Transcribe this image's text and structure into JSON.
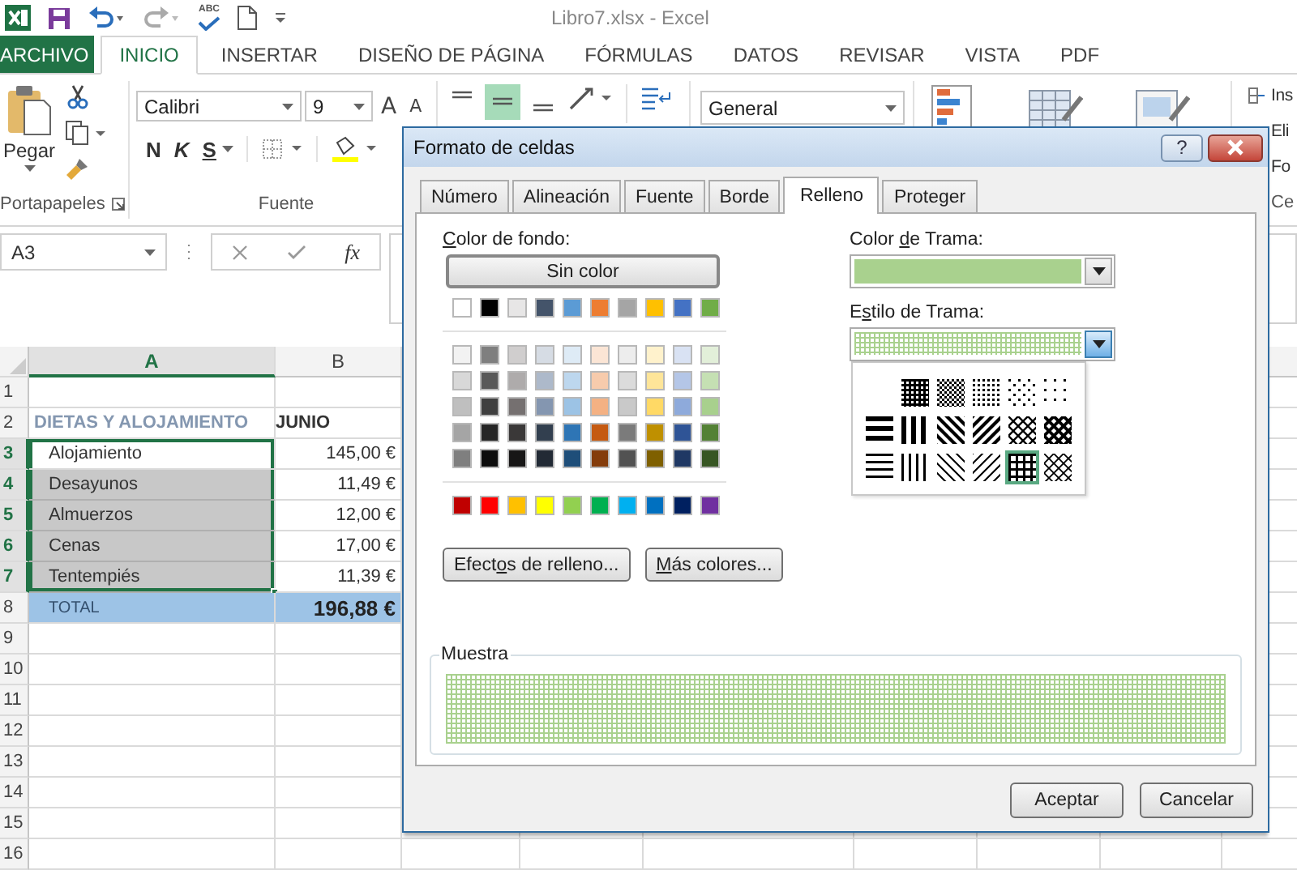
{
  "title_bar": {
    "title": "Libro7.xlsx - Excel",
    "spelling_label": "ABC"
  },
  "ribbon_tabs": [
    {
      "label": "ARCHIVO",
      "kind": "file",
      "selected": false
    },
    {
      "label": "INICIO",
      "kind": "tab",
      "selected": true
    },
    {
      "label": "INSERTAR",
      "kind": "tab",
      "selected": false
    },
    {
      "label": "DISEÑO DE PÁGINA",
      "kind": "tab",
      "selected": false
    },
    {
      "label": "FÓRMULAS",
      "kind": "tab",
      "selected": false
    },
    {
      "label": "DATOS",
      "kind": "tab",
      "selected": false
    },
    {
      "label": "REVISAR",
      "kind": "tab",
      "selected": false
    },
    {
      "label": "VISTA",
      "kind": "tab",
      "selected": false
    },
    {
      "label": "PDF",
      "kind": "tab",
      "selected": false
    }
  ],
  "ribbon": {
    "paste": "Pegar",
    "clipboard_group": "Portapapeles",
    "font_name": "Calibri",
    "font_size": "9",
    "grow_font": "A",
    "shrink_font": "A",
    "bold": "N",
    "italic": "K",
    "underline": "S",
    "font_group": "Fuente",
    "alignments": [
      {
        "kind": "top",
        "selected": false
      },
      {
        "kind": "middle",
        "selected": true
      },
      {
        "kind": "bottom",
        "selected": false
      }
    ],
    "number_format": "General",
    "cells_commands": [
      "Ins",
      "Eli",
      "Fo"
    ],
    "cells_group": "Ce"
  },
  "formula_bar": {
    "name_box": "A3",
    "function_label": "fx"
  },
  "sheet": {
    "columns": [
      {
        "label": "A",
        "selected": true
      },
      {
        "label": "B",
        "selected": false
      }
    ],
    "rows": [
      {
        "number": "1",
        "selected": false,
        "kind": "blank"
      },
      {
        "number": "2",
        "selected": false,
        "kind": "heading",
        "cells": [
          {
            "text": "DIETAS Y ALOJAMIENTO",
            "shaded": false
          },
          {
            "text": "JUNIO",
            "shaded": false
          }
        ]
      },
      {
        "number": "3",
        "selected": true,
        "kind": "item",
        "cells": [
          {
            "text": "Alojamiento",
            "shaded": false
          },
          {
            "text": "145,00 €",
            "shaded": false
          }
        ]
      },
      {
        "number": "4",
        "selected": true,
        "kind": "item",
        "cells": [
          {
            "text": "Desayunos",
            "shaded": true
          },
          {
            "text": "11,49 €",
            "shaded": false
          }
        ]
      },
      {
        "number": "5",
        "selected": true,
        "kind": "item",
        "cells": [
          {
            "text": "Almuerzos",
            "shaded": true
          },
          {
            "text": "12,00 €",
            "shaded": false
          }
        ]
      },
      {
        "number": "6",
        "selected": true,
        "kind": "item",
        "cells": [
          {
            "text": "Cenas",
            "shaded": true
          },
          {
            "text": "17,00 €",
            "shaded": false
          }
        ]
      },
      {
        "number": "7",
        "selected": true,
        "kind": "item",
        "cells": [
          {
            "text": "Tentempiés",
            "shaded": true
          },
          {
            "text": "11,39 €",
            "shaded": false
          }
        ]
      },
      {
        "number": "8",
        "selected": false,
        "kind": "total",
        "cells": [
          {
            "text": "TOTAL",
            "shaded": false
          },
          {
            "text": "196,88 €",
            "shaded": false
          }
        ]
      },
      {
        "number": "9",
        "selected": false,
        "kind": "blank"
      },
      {
        "number": "10",
        "selected": false,
        "kind": "blank"
      },
      {
        "number": "11",
        "selected": false,
        "kind": "blank"
      },
      {
        "number": "12",
        "selected": false,
        "kind": "blank"
      },
      {
        "number": "13",
        "selected": false,
        "kind": "blank"
      },
      {
        "number": "14",
        "selected": false,
        "kind": "blank"
      },
      {
        "number": "15",
        "selected": false,
        "kind": "blank"
      },
      {
        "number": "16",
        "selected": false,
        "kind": "blank"
      }
    ]
  },
  "dialog": {
    "title": "Formato de celdas",
    "help_button": "?",
    "tabs": [
      {
        "label": "Número",
        "selected": false
      },
      {
        "label": "Alineación",
        "selected": false
      },
      {
        "label": "Fuente",
        "selected": false
      },
      {
        "label": "Borde",
        "selected": false
      },
      {
        "label": "Relleno",
        "selected": true
      },
      {
        "label": "Proteger",
        "selected": false
      }
    ],
    "background_color": {
      "label": {
        "key": "C",
        "post": "olor de fondo:"
      },
      "no_color_button": "Sin color",
      "theme_colors": [
        {
          "color": "#ffffff"
        },
        {
          "color": "#000000"
        },
        {
          "color": "#e7e6e6"
        },
        {
          "color": "#44546a"
        },
        {
          "color": "#5b9bd5"
        },
        {
          "color": "#ed7d31"
        },
        {
          "color": "#a5a5a5"
        },
        {
          "color": "#ffc000"
        },
        {
          "color": "#4472c4"
        },
        {
          "color": "#70ad47"
        }
      ],
      "shade_rows": [
        [
          {
            "color": "#f2f2f2"
          },
          {
            "color": "#7f7f7f"
          },
          {
            "color": "#d0cece"
          },
          {
            "color": "#d6dce4"
          },
          {
            "color": "#deebf6"
          },
          {
            "color": "#fbe5d5"
          },
          {
            "color": "#ededed"
          },
          {
            "color": "#fff2cc"
          },
          {
            "color": "#d9e2f3"
          },
          {
            "color": "#e2efd9"
          }
        ],
        [
          {
            "color": "#d8d8d8"
          },
          {
            "color": "#595959"
          },
          {
            "color": "#aeabab"
          },
          {
            "color": "#adb9ca"
          },
          {
            "color": "#bdd7ee"
          },
          {
            "color": "#f7cbac"
          },
          {
            "color": "#dbdbdb"
          },
          {
            "color": "#fee599"
          },
          {
            "color": "#b4c6e7"
          },
          {
            "color": "#c5e0b3"
          }
        ],
        [
          {
            "color": "#bfbfbf"
          },
          {
            "color": "#3f3f3f"
          },
          {
            "color": "#757070"
          },
          {
            "color": "#8496b0"
          },
          {
            "color": "#9cc3e5"
          },
          {
            "color": "#f4b183"
          },
          {
            "color": "#c9c9c9"
          },
          {
            "color": "#ffd965"
          },
          {
            "color": "#8eaadb"
          },
          {
            "color": "#a8d08d"
          }
        ],
        [
          {
            "color": "#a5a5a5"
          },
          {
            "color": "#262626"
          },
          {
            "color": "#3a3838"
          },
          {
            "color": "#323f4f"
          },
          {
            "color": "#2e75b5"
          },
          {
            "color": "#c55a11"
          },
          {
            "color": "#7b7b7b"
          },
          {
            "color": "#bf9000"
          },
          {
            "color": "#2f5496"
          },
          {
            "color": "#538135"
          }
        ],
        [
          {
            "color": "#7f7f7f"
          },
          {
            "color": "#0c0c0c"
          },
          {
            "color": "#171616"
          },
          {
            "color": "#222a35"
          },
          {
            "color": "#1e4e79"
          },
          {
            "color": "#843c0b"
          },
          {
            "color": "#525252"
          },
          {
            "color": "#7f6000"
          },
          {
            "color": "#1f3864"
          },
          {
            "color": "#375623"
          }
        ]
      ],
      "standard_colors": [
        {
          "color": "#c00000"
        },
        {
          "color": "#ff0000"
        },
        {
          "color": "#ffc000"
        },
        {
          "color": "#ffff00"
        },
        {
          "color": "#92d050"
        },
        {
          "color": "#00b050"
        },
        {
          "color": "#00b0f0"
        },
        {
          "color": "#0070c0"
        },
        {
          "color": "#002060"
        },
        {
          "color": "#7030a0"
        }
      ]
    },
    "fill_effects_button": {
      "pre": "Efect",
      "key": "o",
      "post": "s de relleno..."
    },
    "more_colors_button": {
      "key": "M",
      "post": "ás colores..."
    },
    "pattern_color": {
      "label": {
        "pre": "Color ",
        "key": "d",
        "post": "e Trama:"
      },
      "color": "#a9d18e"
    },
    "pattern_style": {
      "label": {
        "pre": "E",
        "key": "s",
        "post": "tilo de Trama:"
      },
      "expanded": true,
      "options": [
        {
          "kind": "gray-75",
          "selected": false
        },
        {
          "kind": "gray-50",
          "selected": false
        },
        {
          "kind": "gray-25",
          "selected": false
        },
        {
          "kind": "gray-12",
          "selected": false
        },
        {
          "kind": "gray-6",
          "selected": false
        },
        {
          "kind": "thick-horizontal",
          "selected": false
        },
        {
          "kind": "thick-vertical",
          "selected": false
        },
        {
          "kind": "thick-reverse-diagonal",
          "selected": false
        },
        {
          "kind": "thick-diagonal",
          "selected": false
        },
        {
          "kind": "diagonal-crosshatch",
          "selected": false
        },
        {
          "kind": "thick-diagonal-crosshatch",
          "selected": false
        },
        {
          "kind": "thin-horizontal",
          "selected": false
        },
        {
          "kind": "thin-vertical",
          "selected": false
        },
        {
          "kind": "thin-reverse-diagonal",
          "selected": false
        },
        {
          "kind": "thin-diagonal",
          "selected": false
        },
        {
          "kind": "thin-horizontal-crosshatch",
          "selected": true
        },
        {
          "kind": "thin-diagonal-crosshatch",
          "selected": false
        }
      ]
    },
    "sample": {
      "label": "Muestra"
    },
    "buttons": [
      "Aceptar",
      "Cancelar"
    ]
  }
}
